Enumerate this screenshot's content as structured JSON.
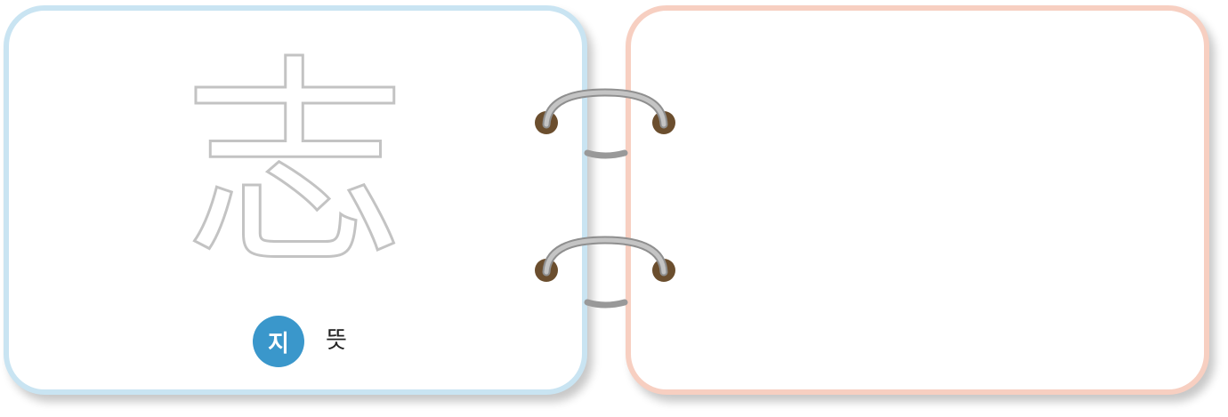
{
  "card_front": {
    "hanja": "志",
    "reading": "지",
    "meaning": "뜻"
  },
  "card_back": {},
  "colors": {
    "front_border": "#c9e4f2",
    "back_border": "#f7cfc1",
    "badge": "#3a97cb",
    "hole": "#6b4e2e",
    "ring": "#b3b3b3",
    "glyph_outline": "#c3c3c3"
  }
}
